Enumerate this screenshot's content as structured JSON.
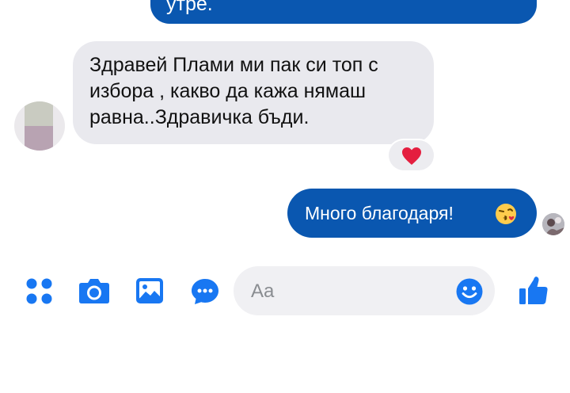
{
  "messages": {
    "top_outgoing_text": "утре.",
    "incoming": {
      "text": "Здравей Плами ми пак си топ с избора , какво да кажа нямаш равна..Здравичка бъди.",
      "reaction": "heart"
    },
    "outgoing": {
      "text": "Много благодаря!",
      "emoji": "face-blowing-kiss"
    }
  },
  "composer": {
    "placeholder": "Aa"
  },
  "toolbar": {
    "icons": [
      "menu-dots-icon",
      "camera-icon",
      "gallery-icon",
      "voice-message-icon",
      "emoji-icon",
      "like-icon"
    ]
  },
  "colors": {
    "accent": "#0a57b0",
    "icon_blue": "#1877f2",
    "incoming_bubble": "#e9e9ee",
    "heart": "#e41e3f"
  }
}
